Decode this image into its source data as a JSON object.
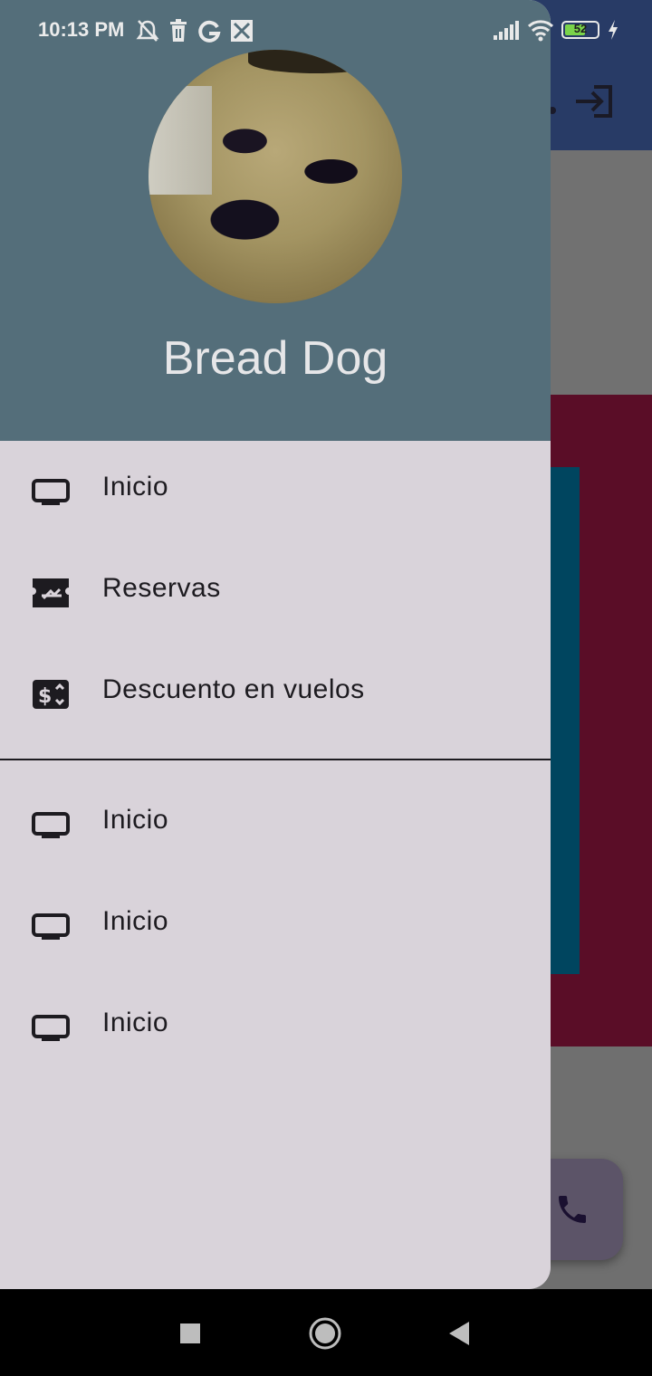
{
  "status_bar": {
    "time": "10:13 PM",
    "left_icons": [
      "bell-off-icon",
      "trash-icon",
      "google-icon",
      "news-icon"
    ],
    "right_icons": [
      "signal-icon",
      "wifi-icon",
      "battery-icon",
      "charging-icon"
    ],
    "battery_level": "52"
  },
  "drawer": {
    "header": {
      "name": "Bread Dog",
      "background_color": "#546e7a"
    },
    "items_primary": [
      {
        "label": "Inicio",
        "icon": "tv-icon"
      },
      {
        "label": "Reservas",
        "icon": "flight-ticket-icon"
      },
      {
        "label": "Descuento en vuelos",
        "icon": "money-icon"
      }
    ],
    "items_secondary": [
      {
        "label": "Inicio",
        "icon": "tv-icon"
      },
      {
        "label": "Inicio",
        "icon": "tv-icon"
      },
      {
        "label": "Inicio",
        "icon": "tv-icon"
      }
    ]
  },
  "background": {
    "appbar_icon": "login-icon",
    "fab_icon": "phone-icon",
    "colors": {
      "appbar": "#283b66",
      "maroon": "#5a0d27",
      "teal": "#00455f"
    }
  },
  "navigation_bar": {
    "buttons": [
      "recents-square-icon",
      "home-circle-icon",
      "back-triangle-icon"
    ]
  }
}
